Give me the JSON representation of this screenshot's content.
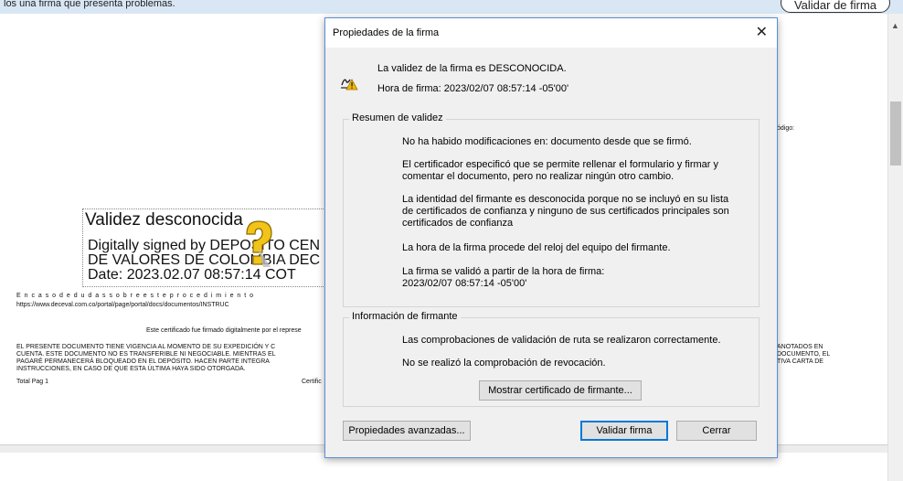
{
  "topbar": {
    "message": "los una firma que presenta problemas.",
    "validate_all_label": "Validar de firma"
  },
  "document": {
    "signature_title": "Validez desconocida",
    "signed_line_1": "Digitally signed by DEPOSITO CEN",
    "signed_line_2": "DE VALORES DE COLOMBIA DEC",
    "date_line": "Date: 2023.02.07 08:57:14 COT",
    "doubt_line_1": "E n   c a s o   d e   d u d a s   s o b r e   e s t e   p r o c e d i m i e n t o",
    "doubt_line_2": "https://www.deceval.com.co/portal/page/portal/docs/documentos/INSTRUC",
    "codigo_label": "ódigo:",
    "certified_line": "Este certificado fue firmado digitalmente por el represe",
    "legal_left_1": "EL PRESENTE DOCUMENTO TIENE VIGENCIA AL MOMENTO DE SU EXPEDICIÓN Y C",
    "legal_left_2": "CUENTA. ESTE DOCUMENTO NO ES TRANSFERIBLE NI NEGOCIABLE. MIENTRAS EL",
    "legal_left_3": "PAGARÉ PERMANECERÁ BLOQUEADO EN EL DEPÓSITO. HACEN PARTE INTEGRA",
    "legal_left_4": "INSTRUCCIONES, EN CASO DE QUE ESTA ÚLTIMA HAYA SIDO OTORGADA.",
    "legal_right_1": "ANOTADOS EN",
    "legal_right_2": "DOCUMENTO, EL",
    "legal_right_3": "TIVA CARTA DE",
    "total_pag": "Total Pag   1",
    "certific": "Certific"
  },
  "dialog": {
    "title": "Propiedades de la firma",
    "close_icon": "close-icon",
    "status_icon": "signature-warning-icon",
    "validity": "La validez de la firma es DESCONOCIDA.",
    "sign_time": "Hora de firma:  2023/02/07 08:57:14 -05'00'",
    "summary": {
      "legend": "Resumen de validez",
      "items": [
        "No ha habido modificaciones en: documento desde que se firmó.",
        "El certificador especificó que se permite rellenar el formulario y firmar y comentar el documento, pero no realizar ningún otro cambio.",
        "La identidad del firmante es desconocida porque no se incluyó en su lista de certificados de confianza y ninguno de sus certificados principales son certificados de confianza",
        "La hora de la firma procede del reloj del equipo del firmante.",
        "La firma se validó a partir de la hora de firma:\n2023/02/07 08:57:14 -05'00'"
      ]
    },
    "signer": {
      "legend": "Información de firmante",
      "items": [
        "Las comprobaciones de validación de ruta se realizaron correctamente.",
        "No se realizó la comprobación de revocación."
      ],
      "show_cert_label": "Mostrar certificado de firmante..."
    },
    "buttons": {
      "advanced": "Propiedades avanzadas...",
      "validate": "Validar firma",
      "close": "Cerrar"
    }
  },
  "colors": {
    "accent": "#0078d7",
    "topbar": "#d9e7f5",
    "dialog_bg": "#f0f0f0"
  }
}
